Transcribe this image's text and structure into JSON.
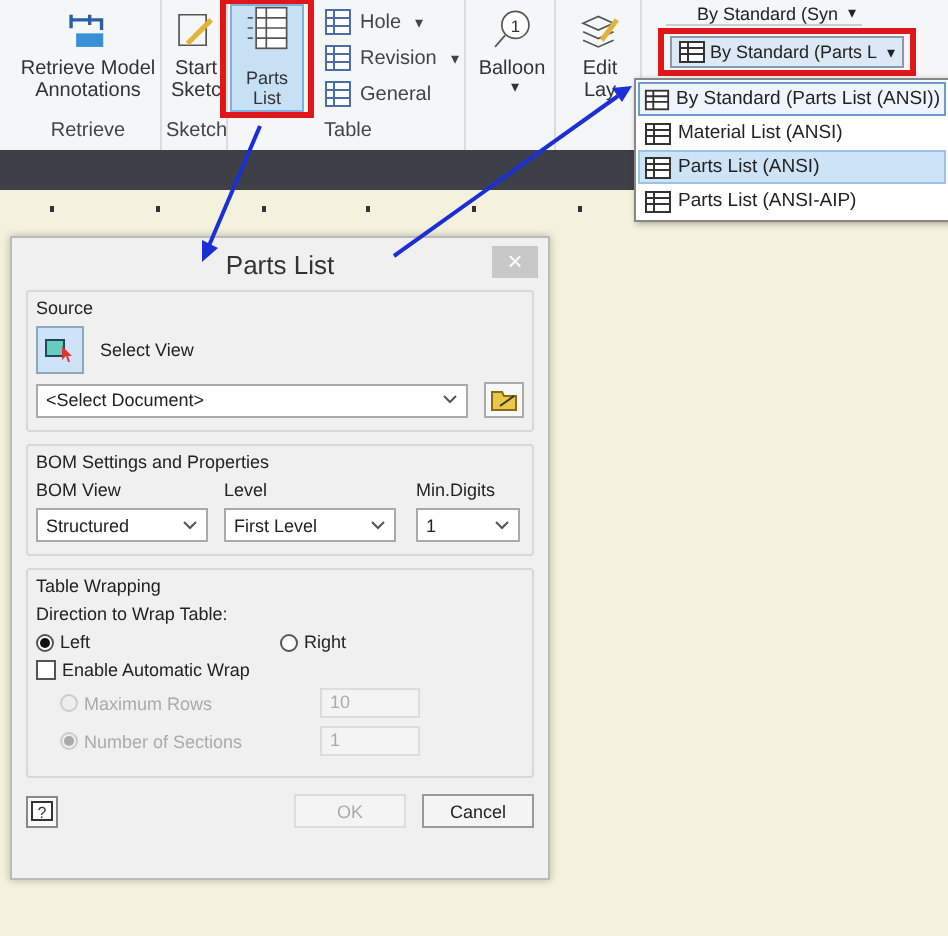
{
  "ribbon": {
    "groups": [
      {
        "label": "Retrieve",
        "tools": [
          {
            "label": "Retrieve Model Annotations",
            "selected": false
          }
        ]
      },
      {
        "label": "Sketch",
        "tools": [
          {
            "label": "Start Sketc",
            "selected": false
          }
        ]
      },
      {
        "label": "Table",
        "tools": [
          {
            "label": "Parts List",
            "selected": true
          }
        ],
        "small_tools": [
          {
            "label": "Hole",
            "caret": "▾"
          },
          {
            "label": "Revision",
            "caret": "▾"
          },
          {
            "label": "General"
          }
        ]
      },
      {
        "tools": [
          {
            "label": "Balloon",
            "badge": "1",
            "caret": "▾",
            "selected": false
          }
        ]
      },
      {
        "tools": [
          {
            "label": "Edit Lay",
            "selected": false
          }
        ]
      }
    ],
    "style_combos": [
      {
        "value": "By Standard (Syn",
        "caret": "▾"
      },
      {
        "value": "By Standard (Parts L",
        "caret": "▾"
      }
    ]
  },
  "style_list": [
    {
      "label": "By Standard (Parts List (ANSI))",
      "selected": true,
      "hovered": false
    },
    {
      "label": "Material List (ANSI)",
      "selected": false,
      "hovered": false
    },
    {
      "label": "Parts List (ANSI)",
      "selected": false,
      "hovered": true
    },
    {
      "label": "Parts List (ANSI-AIP)",
      "selected": false,
      "hovered": false
    }
  ],
  "dialog": {
    "title": "Parts List",
    "close": "×",
    "source": {
      "legend": "Source",
      "select_view": "Select View",
      "document": {
        "value": "<Select Document>"
      }
    },
    "bom": {
      "legend": "BOM Settings and Properties",
      "fields": [
        {
          "label": "BOM View",
          "value": "Structured"
        },
        {
          "label": "Level",
          "value": "First Level"
        },
        {
          "label": "Min.Digits",
          "value": "1"
        }
      ]
    },
    "wrapping": {
      "legend": "Table Wrapping",
      "direction_label": "Direction to Wrap Table:",
      "directions": [
        {
          "label": "Left",
          "selected": true
        },
        {
          "label": "Right",
          "selected": false
        }
      ],
      "auto_wrap": {
        "label": "Enable Automatic Wrap",
        "checked": false
      },
      "options": [
        {
          "label": "Maximum Rows",
          "value": "10",
          "selected": false,
          "disabled": true
        },
        {
          "label": "Number of Sections",
          "value": "1",
          "selected": true,
          "disabled": true
        }
      ]
    },
    "help": "?",
    "buttons": [
      {
        "label": "OK",
        "disabled": true
      },
      {
        "label": "Cancel",
        "disabled": false
      }
    ]
  }
}
